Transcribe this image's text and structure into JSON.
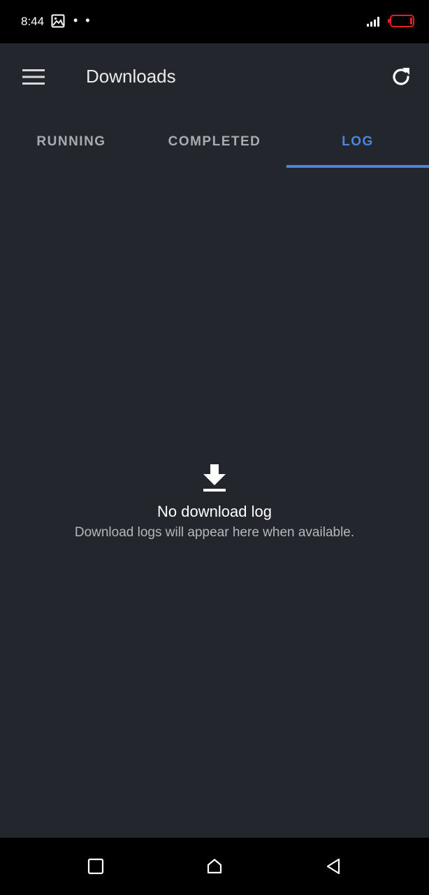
{
  "status_bar": {
    "time": "8:44",
    "photo_icon": "image-icon",
    "dots": "• •",
    "signal_icon": "signal-icon",
    "battery_icon": "battery-low-icon",
    "battery_color": "#e02020"
  },
  "toolbar": {
    "menu_icon": "menu-icon",
    "title": "Downloads",
    "refresh_icon": "refresh-icon"
  },
  "tabs": [
    {
      "label": "RUNNING",
      "selected": false
    },
    {
      "label": "COMPLETED",
      "selected": false
    },
    {
      "label": "LOG",
      "selected": true
    }
  ],
  "empty_state": {
    "icon": "download-icon",
    "title": "No download log",
    "subtitle": "Download logs will appear here when available."
  },
  "nav_bar": {
    "recents_icon": "square-icon",
    "home_icon": "home-icon",
    "back_icon": "back-triangle-icon"
  },
  "colors": {
    "background": "#23272d",
    "accent": "#4a86e0",
    "tab_inactive": "#a9abb0",
    "title_text": "#eaeaea"
  }
}
